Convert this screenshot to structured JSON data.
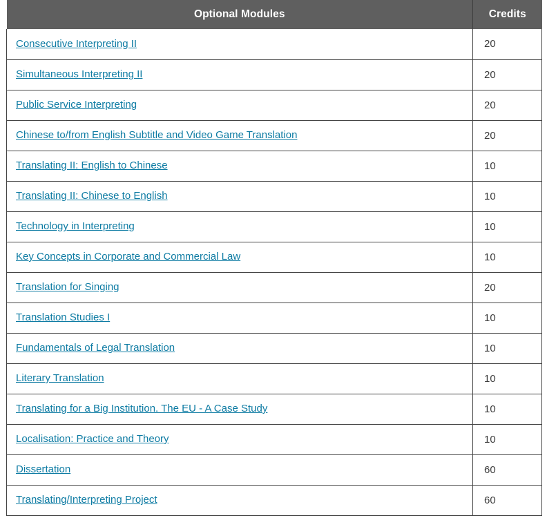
{
  "table": {
    "columns": [
      {
        "key": "module",
        "label": "Optional Modules",
        "align": "center"
      },
      {
        "key": "credits",
        "label": "Credits",
        "align": "center"
      }
    ],
    "header": {
      "module_label": "Optional Modules",
      "credits_label": "Credits",
      "background_color": "#5f5f5f",
      "text_color": "#ffffff"
    },
    "link_color": "#0d7ba3",
    "border_color": "#444444",
    "rows": [
      {
        "module": "Consecutive Interpreting II",
        "credits": "20"
      },
      {
        "module": "Simultaneous Interpreting II",
        "credits": "20"
      },
      {
        "module": "Public Service Interpreting",
        "credits": "20"
      },
      {
        "module": "Chinese to/from English Subtitle and Video Game Translation",
        "credits": "20"
      },
      {
        "module": "Translating II: English to Chinese",
        "credits": "10"
      },
      {
        "module": "Translating II: Chinese to English",
        "credits": "10"
      },
      {
        "module": "Technology in Interpreting",
        "credits": "10"
      },
      {
        "module": "Key Concepts in Corporate and Commercial Law",
        "credits": "10"
      },
      {
        "module": "Translation for Singing",
        "credits": "20"
      },
      {
        "module": "Translation Studies I",
        "credits": "10"
      },
      {
        "module": "Fundamentals of Legal Translation",
        "credits": "10"
      },
      {
        "module": "Literary Translation",
        "credits": "10"
      },
      {
        "module": "Translating for a Big Institution. The EU - A Case Study",
        "credits": "10"
      },
      {
        "module": "Localisation: Practice and Theory",
        "credits": "10"
      },
      {
        "module": "Dissertation",
        "credits": "60"
      },
      {
        "module": "Translating/Interpreting Project",
        "credits": "60"
      }
    ]
  }
}
